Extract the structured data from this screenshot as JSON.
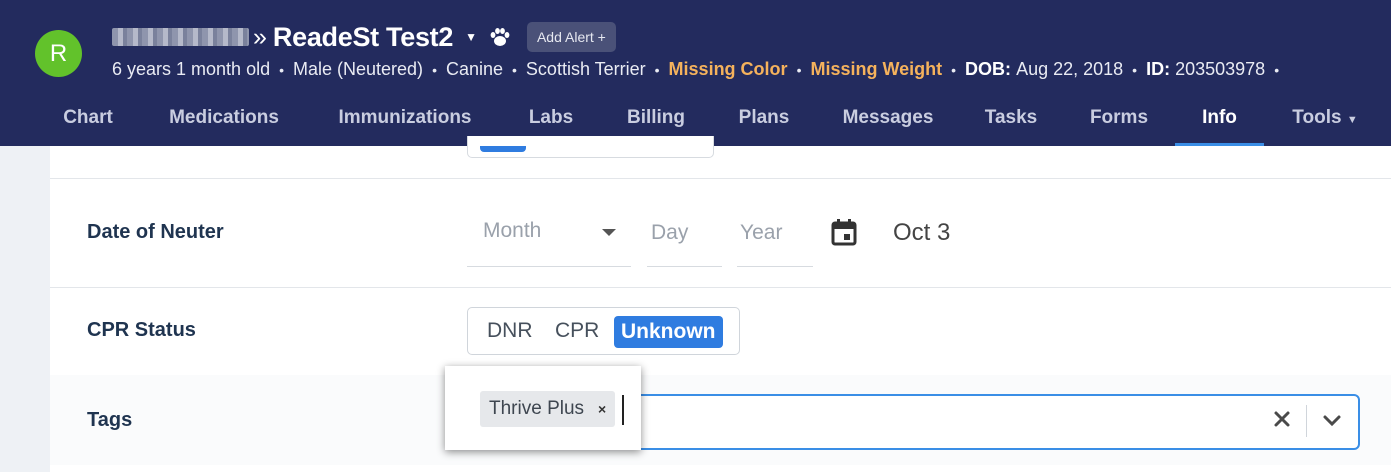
{
  "header": {
    "avatar_letter": "R",
    "patient_name": "ReadeSt Test2",
    "separator": "»",
    "alert_button": "Add Alert +",
    "info": {
      "age": "6 years 1 month old",
      "sex": "Male (Neutered)",
      "species": "Canine",
      "breed": "Scottish Terrier",
      "missing_color": "Missing Color",
      "missing_weight": "Missing Weight",
      "dob_label": "DOB:",
      "dob_value": "Aug 22, 2018",
      "id_label": "ID:",
      "id_value": "203503978",
      "bullet": "•"
    },
    "colors": {
      "background": "#232b5e",
      "warning": "#f5b25c",
      "avatar": "#62c22b",
      "accent": "#3a8ee6"
    }
  },
  "nav": {
    "tabs": [
      {
        "label": "Chart"
      },
      {
        "label": "Medications"
      },
      {
        "label": "Immunizations"
      },
      {
        "label": "Labs"
      },
      {
        "label": "Billing"
      },
      {
        "label": "Plans"
      },
      {
        "label": "Messages"
      },
      {
        "label": "Tasks"
      },
      {
        "label": "Forms"
      },
      {
        "label": "Info",
        "active": true
      },
      {
        "label": "Tools",
        "has_dropdown": true
      }
    ]
  },
  "form": {
    "date_of_neuter": {
      "label": "Date of Neuter",
      "month_placeholder": "Month",
      "day_placeholder": "Day",
      "year_placeholder": "Year",
      "calendar_icon": "calendar-icon",
      "display_value": "Oct 3"
    },
    "cpr_status": {
      "label": "CPR Status",
      "options": [
        "DNR",
        "CPR",
        "Unknown"
      ],
      "selected": "Unknown"
    },
    "tags": {
      "label": "Tags",
      "chips": [
        {
          "label": "Thrive Plus",
          "remove": "×"
        }
      ],
      "clear_icon": "close-icon",
      "dropdown_icon": "chevron-down-icon"
    }
  }
}
